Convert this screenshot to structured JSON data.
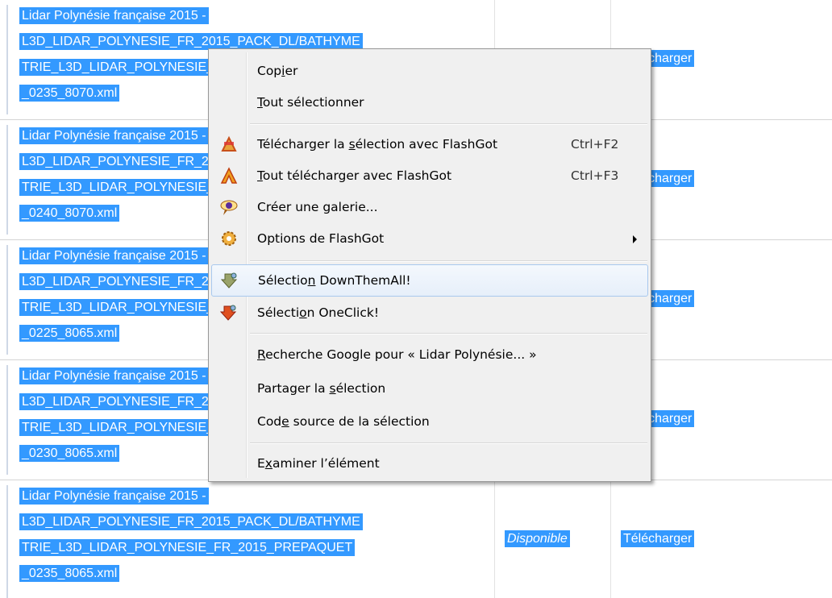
{
  "rows": [
    {
      "lines": [
        "Lidar Polynésie française 2015 -",
        "L3D_LIDAR_POLYNESIE_FR_2015_PACK_DL/BATHYME",
        "TRIE_L3D_LIDAR_POLYNESIE_FR_2015_PREPAQUET",
        "_0235_8070.xml"
      ],
      "status": "",
      "link": "Télécharger"
    },
    {
      "lines": [
        "Lidar Polynésie française 2015 -",
        "L3D_LIDAR_POLYNESIE_FR_2015_PACK_DL/BATHYME",
        "TRIE_L3D_LIDAR_POLYNESIE_FR_2015_PREPAQUET",
        "_0240_8070.xml"
      ],
      "status": "",
      "link": "Télécharger"
    },
    {
      "lines": [
        "Lidar Polynésie française 2015 -",
        "L3D_LIDAR_POLYNESIE_FR_2015_PACK_DL/BATHYME",
        "TRIE_L3D_LIDAR_POLYNESIE_FR_2015_PREPAQUET",
        "_0225_8065.xml"
      ],
      "status": "",
      "link": "Télécharger"
    },
    {
      "lines": [
        "Lidar Polynésie française 2015 -",
        "L3D_LIDAR_POLYNESIE_FR_2015_PACK_DL/BATHYME",
        "TRIE_L3D_LIDAR_POLYNESIE_FR_2015_PREPAQUET",
        "_0230_8065.xml"
      ],
      "status": "",
      "link": "Télécharger"
    },
    {
      "lines": [
        "Lidar Polynésie française 2015 -",
        "L3D_LIDAR_POLYNESIE_FR_2015_PACK_DL/BATHYME",
        "TRIE_L3D_LIDAR_POLYNESIE_FR_2015_PREPAQUET",
        "_0235_8065.xml"
      ],
      "status": "Disponible",
      "link": "Télécharger"
    }
  ],
  "menu": {
    "copy": {
      "pre": "Cop",
      "u": "i",
      "post": "er"
    },
    "select_all": {
      "pre": "",
      "u": "T",
      "post": "out sélectionner"
    },
    "flashgot_selection": {
      "pre": "Télécharger la ",
      "u": "s",
      "post": "élection avec FlashGot",
      "shortcut": "Ctrl+F2",
      "icon": "flashgot-selection-icon"
    },
    "flashgot_all": {
      "pre": "",
      "u": "T",
      "post": "out télécharger avec FlashGot",
      "shortcut": "Ctrl+F3",
      "icon": "flashgot-icon"
    },
    "gallery": {
      "label": "Créer une galerie...",
      "icon": "eye-icon"
    },
    "flashgot_options": {
      "label": "Options de FlashGot",
      "icon": "flashgot-options-icon"
    },
    "dta_selection": {
      "pre": "Sélectio",
      "u": "n",
      "post": " DownThemAll!",
      "icon": "downthemall-icon"
    },
    "oneclick_selection": {
      "pre": "Sélecti",
      "u": "o",
      "post": "n OneClick!",
      "icon": "oneclick-icon"
    },
    "google_search": {
      "pre": "",
      "u": "R",
      "post": "echerche Google pour « Lidar Polynésie... »"
    },
    "share": {
      "pre": "Partager la ",
      "u": "s",
      "post": "élection"
    },
    "view_source": {
      "pre": "Cod",
      "u": "e",
      "post": " source de la sélection"
    },
    "inspect": {
      "pre": "E",
      "u": "x",
      "post": "aminer l’élément"
    }
  },
  "colors": {
    "selection": "#3399ff",
    "menu_bg": "#f0f0f0",
    "highlight_border": "#a8c8ee"
  }
}
